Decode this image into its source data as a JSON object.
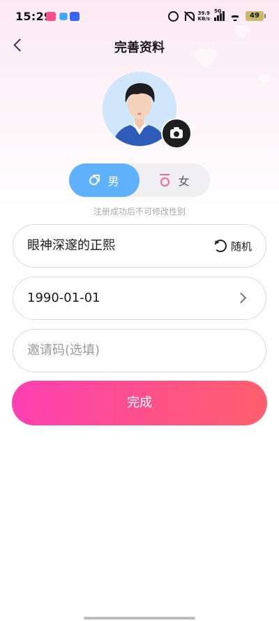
{
  "status_bar": {
    "time": "15:29",
    "net_speed_value": "39.9",
    "net_speed_unit": "KB/s",
    "network_label": "5G",
    "battery": "49"
  },
  "header": {
    "title": "完善资料"
  },
  "gender": {
    "male_label": "男",
    "female_label": "女",
    "selected": "male",
    "hint": "注册成功后不可修改性别"
  },
  "form": {
    "nickname": "眼神深邃的正熙",
    "random_label": "随机",
    "birthday": "1990-01-01",
    "invite_placeholder": "邀请码(选填)",
    "submit_label": "完成"
  },
  "colors": {
    "accent_male": "#5fb1fb",
    "accent_female": "#f0679a",
    "submit_gradient_start": "#fd3fb2",
    "submit_gradient_end": "#ff5f6e"
  },
  "icons": {
    "back": "back-arrow-icon",
    "camera": "camera-icon",
    "male": "male-symbol-icon",
    "female": "female-symbol-icon",
    "refresh": "refresh-icon",
    "chevron": "chevron-right-icon"
  }
}
